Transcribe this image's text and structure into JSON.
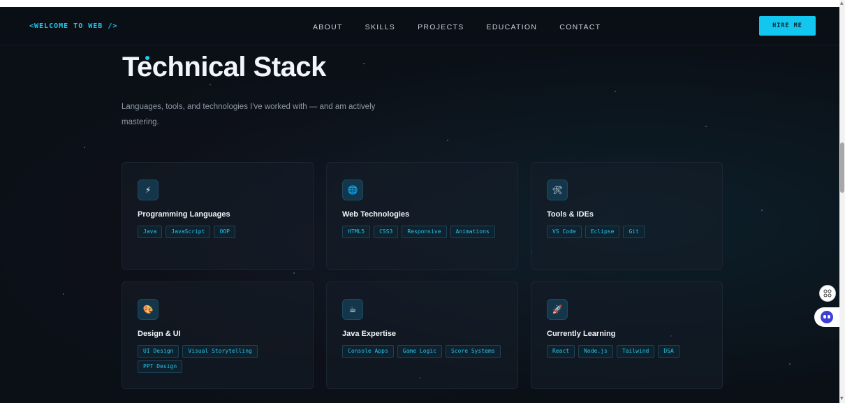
{
  "nav": {
    "logo": "<WELCOME TO WEB />",
    "links": [
      "ABOUT",
      "SKILLS",
      "PROJECTS",
      "EDUCATION",
      "CONTACT"
    ],
    "hire_label": "HIRE ME"
  },
  "section": {
    "title": "Technical Stack",
    "subtitle": "Languages, tools, and technologies I've worked with — and am actively mastering."
  },
  "cards": [
    {
      "title": "Programming Languages",
      "icon": "lightning-icon",
      "glyph": "⚡",
      "tags": [
        "Java",
        "JavaScript",
        "OOP"
      ]
    },
    {
      "title": "Web Technologies",
      "icon": "globe-icon",
      "glyph": "🌐",
      "tags": [
        "HTML5",
        "CSS3",
        "Responsive",
        "Animations"
      ]
    },
    {
      "title": "Tools & IDEs",
      "icon": "tools-icon",
      "glyph": "🛠",
      "tags": [
        "VS Code",
        "Eclipse",
        "Git"
      ]
    },
    {
      "title": "Design & UI",
      "icon": "palette-icon",
      "glyph": "🎨",
      "tags": [
        "UI Design",
        "Visual Storytelling",
        "PPT Design"
      ]
    },
    {
      "title": "Java Expertise",
      "icon": "coffee-icon",
      "glyph": "☕",
      "tags": [
        "Console Apps",
        "Game Logic",
        "Score Systems"
      ]
    },
    {
      "title": "Currently Learning",
      "icon": "rocket-icon",
      "glyph": "🚀",
      "tags": [
        "React",
        "Node.js",
        "Tailwind",
        "DSA"
      ]
    }
  ],
  "colors": {
    "accent": "#12c6ef",
    "background": "#0b1017",
    "card": "#161e28"
  }
}
